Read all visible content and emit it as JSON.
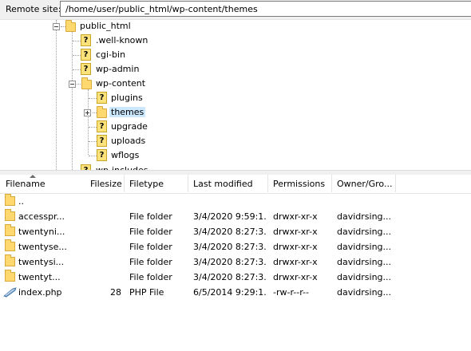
{
  "site_bar": {
    "label": "Remote site:",
    "path": "/home/user/public_html/wp-content/themes"
  },
  "tree": {
    "public_html": "public_html",
    "children": [
      {
        "label": ".well-known",
        "icon": "unknown-folder-icon"
      },
      {
        "label": "cgi-bin",
        "icon": "unknown-folder-icon"
      },
      {
        "label": "wp-admin",
        "icon": "unknown-folder-icon"
      },
      {
        "label": "wp-content",
        "icon": "folder-open-icon"
      }
    ],
    "wp_content_children": [
      {
        "label": "plugins",
        "icon": "unknown-folder-icon"
      },
      {
        "label": "themes",
        "icon": "folder-icon",
        "selected": true
      },
      {
        "label": "upgrade",
        "icon": "unknown-folder-icon"
      },
      {
        "label": "uploads",
        "icon": "unknown-folder-icon"
      },
      {
        "label": "wflogs",
        "icon": "unknown-folder-icon"
      }
    ],
    "cut_off_label": "wp-includes"
  },
  "columns": {
    "filename": "Filename",
    "filesize": "Filesize",
    "filetype": "Filetype",
    "last_modified": "Last modified",
    "permissions": "Permissions",
    "owner": "Owner/Gro..."
  },
  "files": [
    {
      "name": "..",
      "size": "",
      "type": "",
      "modified": "",
      "perms": "",
      "owner": "",
      "icon": "folder-icon"
    },
    {
      "name": "accesspr...",
      "size": "",
      "type": "File folder",
      "modified": "3/4/2020 9:59:1...",
      "perms": "drwxr-xr-x",
      "owner": "davidrsing...",
      "icon": "folder-icon"
    },
    {
      "name": "twentyni...",
      "size": "",
      "type": "File folder",
      "modified": "3/4/2020 8:27:3...",
      "perms": "drwxr-xr-x",
      "owner": "davidrsing...",
      "icon": "folder-icon"
    },
    {
      "name": "twentyse...",
      "size": "",
      "type": "File folder",
      "modified": "3/4/2020 8:27:3...",
      "perms": "drwxr-xr-x",
      "owner": "davidrsing...",
      "icon": "folder-icon"
    },
    {
      "name": "twentysi...",
      "size": "",
      "type": "File folder",
      "modified": "3/4/2020 8:27:3...",
      "perms": "drwxr-xr-x",
      "owner": "davidrsing...",
      "icon": "folder-icon"
    },
    {
      "name": "twentyt...",
      "size": "",
      "type": "File folder",
      "modified": "3/4/2020 8:27:3...",
      "perms": "drwxr-xr-x",
      "owner": "davidrsing...",
      "icon": "folder-icon"
    },
    {
      "name": "index.php",
      "size": "28",
      "type": "PHP File",
      "modified": "6/5/2014 9:29:1...",
      "perms": "-rw-r--r--",
      "owner": "davidrsing...",
      "icon": "php-file-icon"
    }
  ]
}
